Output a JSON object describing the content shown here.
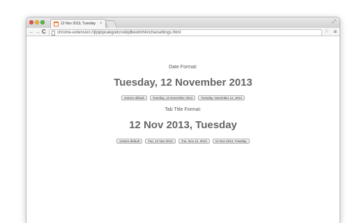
{
  "browser": {
    "tab_title": "12 Nov 2013, Tuesday",
    "tab_close": "×",
    "url": "chrome-extension://jlpiplpcakgodcnoikjdbeolmhkncha/settings.html"
  },
  "icons": {
    "back": "arrow-left-icon",
    "forward": "arrow-right-icon",
    "reload": "reload-icon",
    "star": "star-icon",
    "menu": "hamburger-menu-icon"
  },
  "settings": {
    "date_format_label": "Date Format:",
    "date_format_preview": "Tuesday, 12 November 2013",
    "date_format_options": [
      "restore default",
      "Tuesday, 12 November 2013",
      "Tuesday, November 12, 2013"
    ],
    "tab_title_label": "Tab Title Format:",
    "tab_title_preview": "12 Nov 2013, Tuesday",
    "tab_title_options": [
      "restore default",
      "Tue, 12 Nov 2013",
      "Tue, Nov 12, 2013",
      "12 Nov 2013, Tuesday"
    ]
  }
}
